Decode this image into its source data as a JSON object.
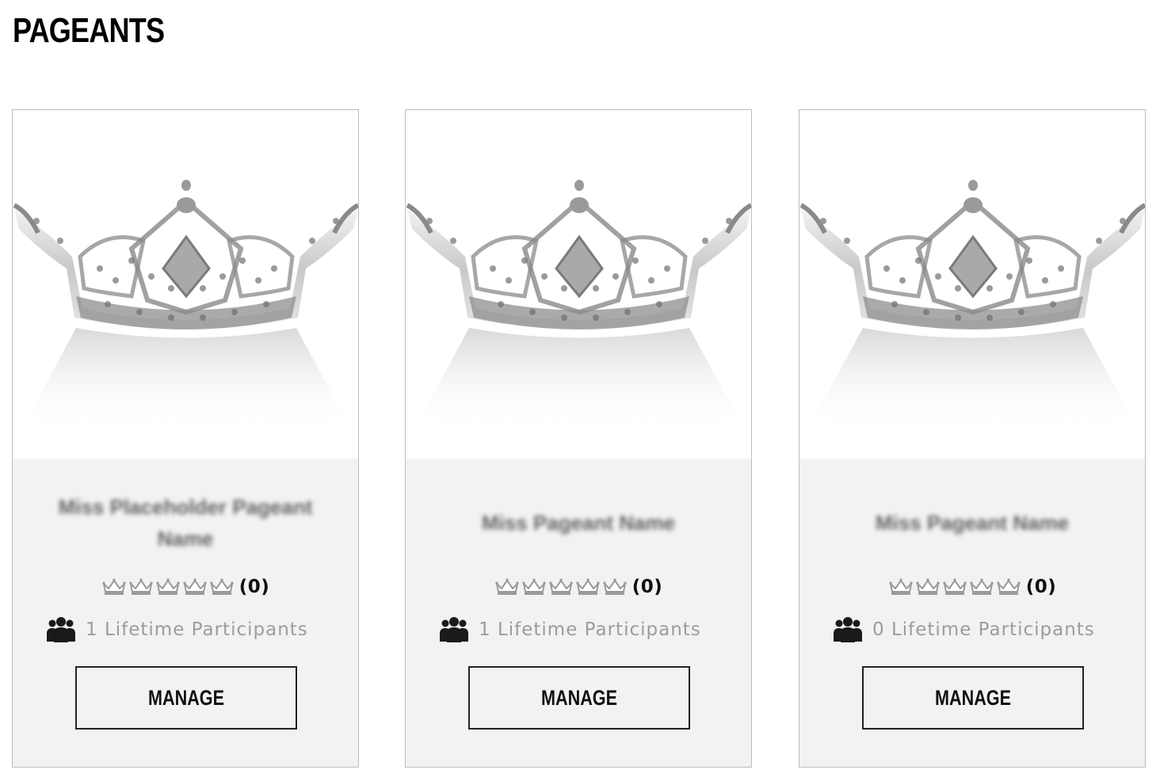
{
  "page": {
    "title": "PAGEANTS"
  },
  "pageants": [
    {
      "image_alt": "crown-image",
      "name": "Miss Placeholder Pageant Name",
      "rating_count": "(0)",
      "stars_total": 5,
      "participants": "1 Lifetime Participants",
      "manage_label": "MANAGE"
    },
    {
      "image_alt": "crown-image",
      "name": "Miss Pageant Name",
      "rating_count": "(0)",
      "stars_total": 5,
      "participants": "1 Lifetime Participants",
      "manage_label": "MANAGE"
    },
    {
      "image_alt": "crown-image",
      "name": "Miss Pageant Name",
      "rating_count": "(0)",
      "stars_total": 5,
      "participants": "0 Lifetime Participants",
      "manage_label": "MANAGE"
    }
  ],
  "colors": {
    "card_background": "#f2f2f2",
    "card_border": "#bdbdbd",
    "muted_text": "#9c9c9c",
    "crown_outline": "#9a9a9a"
  }
}
